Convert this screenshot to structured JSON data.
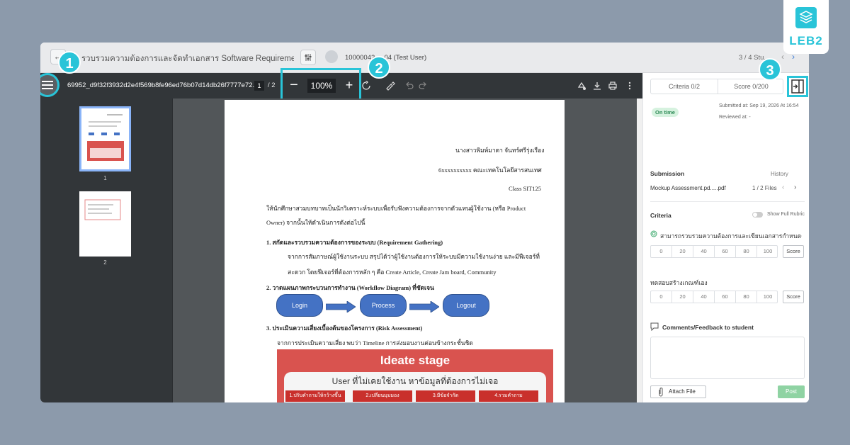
{
  "topbar": {
    "title": "รวบรวมความต้องการและจัดทำเอกสาร Software Requirement Specificatio...",
    "user": "10000042 ... 04 (Test User)",
    "student_count": "3 / 4 Stu...",
    "back_glyph": "←",
    "prev_glyph": "‹",
    "next_glyph": "›"
  },
  "pdf_toolbar": {
    "file_name": "69952_d9f32f3932d2e4f569b8fe96ed76b07d14db26f7777e72...",
    "current_page": "1",
    "page_sep": "/ 2",
    "zoom": "100%",
    "zoom_minus": "−",
    "zoom_plus": "+"
  },
  "thumbnails": [
    {
      "label": "1"
    },
    {
      "label": "2"
    }
  ],
  "document": {
    "name_line": "นางสาวพิมพ์มาดา จันทร์ศรีรุ่งเรือง",
    "id_line": "6xxxxxxxxxx คณะเทคโนโลยีสารสนเทศ",
    "class_line": "Class SIT125",
    "intro_1": "ให้นักศึกษาสวมบทบาทเป็นนักวิเคราะห์ระบบเพื่อรับฟังความต้องการจากตัวแทนผู้ใช้งาน (หรือ Product",
    "intro_2": "Owner) จากนั้นให้ดำเนินการดังต่อไปนี้",
    "item1_title": "1.   สกัดและรวบรวมความต้องการของระบบ (Requirement Gathering)",
    "item1_text_1": "จากการสัมภาษณ์ผู้ใช้งานระบบ สรุปได้ว่าผู้ใช้งานต้องการให้ระบบมีความใช้งานง่าย และมีฟีเจอร์ที่",
    "item1_text_2": "สะดวก โดยฟีเจอร์ที่ต้องการหลัก ๆ คือ Create Article, Create Jam board, Community",
    "item2_title": "2.   วาดแผนภาพกระบวนการทำงาน (Workflow Diagram) ที่ชัดเจน",
    "flow": [
      "Login",
      "Process",
      "Logout"
    ],
    "item3_title": "3.   ประเมินความเสี่ยงเบื้องต้นของโครงการ (Risk Assessment)",
    "item3_text": "จากการประเมินความเสี่ยง พบว่า Timeline การส่งมอบงานค่อนข้างกระชั้นชิด",
    "ideate_title": "Ideate stage",
    "ideate_sub": "User ที่ไม่เคยใช้งาน หาข้อมูลที่ต้องการไม่เจอ",
    "ideate_steps": [
      "1.ปรับคำถามให้กว้างขึ้น",
      "2.เปลี่ยนมุมมอง",
      "3.มีข้อจำกัด",
      "4.รวมคำถาม"
    ]
  },
  "right_panel": {
    "tab_criteria": "Criteria  0/2",
    "tab_score": "Score  0/200",
    "status": "On time",
    "submitted_at": "Submitted at: Sep 19, 2026 At 16:54",
    "reviewed_at": "Reviewed at: -",
    "submission_title": "Submission",
    "history": "History",
    "file_name": "Mockup Assessment.pd.....pdf",
    "file_count": "1 / 2 Files",
    "criteria_title": "Criteria",
    "show_rubric": "Show Full Rubric",
    "criterion_1": "สามารถรวบรวมความต้องการและเขียนเอกสารกำหนดควา...",
    "criterion_2": "ทดสอบสร้างเกณฑ์เอง",
    "score_options": [
      "0",
      "20",
      "40",
      "60",
      "80",
      "100"
    ],
    "score_button": "Score",
    "comments_title": "Comments/Feedback to student",
    "attach_label": "Attach File",
    "post_label": "Post"
  },
  "badges": [
    "1",
    "2",
    "3"
  ],
  "logo": {
    "text": "LEB2"
  },
  "colors": {
    "accent": "#29c4d8",
    "toolbar": "#323639",
    "post": "#8fd3a3"
  }
}
